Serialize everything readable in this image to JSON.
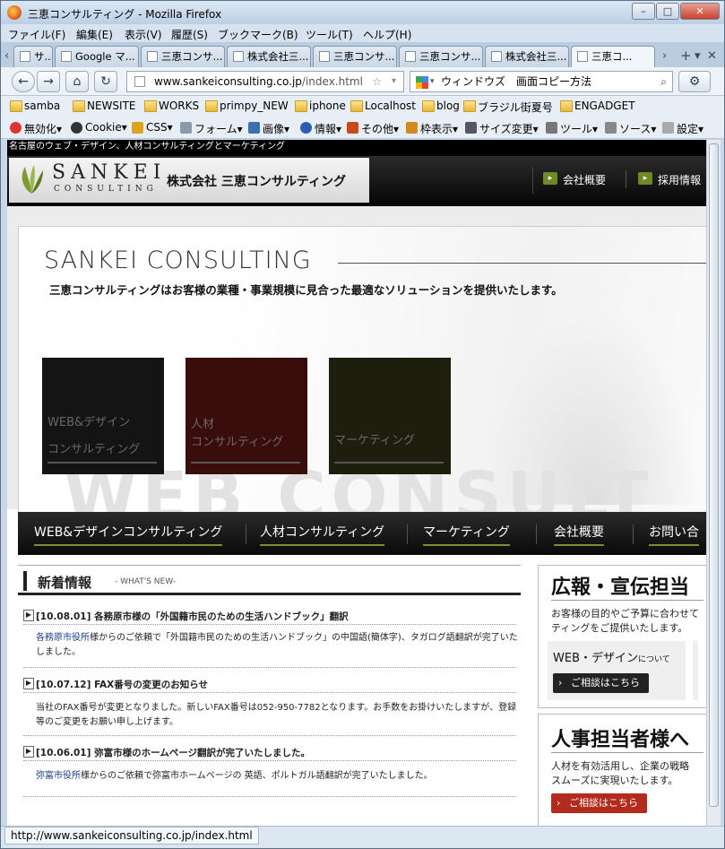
{
  "window": {
    "title": "三恵コンサルティング - Mozilla Firefox",
    "minimize": "–",
    "maximize": "□",
    "close": "✕"
  },
  "menu": [
    "ファイル(F)",
    "編集(E)",
    "表示(V)",
    "履歴(S)",
    "ブックマーク(B)",
    "ツール(T)",
    "ヘルプ(H)"
  ],
  "tabs": [
    {
      "label": "サ..."
    },
    {
      "label": "Google マ..."
    },
    {
      "label": "三恵コンサ..."
    },
    {
      "label": "株式会社三..."
    },
    {
      "label": "三恵コンサ..."
    },
    {
      "label": "三恵コンサ..."
    },
    {
      "label": "株式会社三..."
    },
    {
      "label": "三恵コ...",
      "active": true
    }
  ],
  "nav": {
    "url_host": "www.sankeiconsulting.co.jp",
    "url_path": "/index.html",
    "search_value": "ウィンドウズ　画面コピー方法"
  },
  "bookmarks": [
    "samba",
    "NEWSITE",
    "WORKS",
    "primpy_NEW",
    "iphone",
    "Localhost",
    "blog",
    "ブラジル街夏号",
    "ENGADGET"
  ],
  "devtools": [
    "無効化▾",
    "Cookie▾",
    "CSS▾",
    "フォーム▾",
    "画像▾",
    "情報▾",
    "その他▾",
    "枠表示▾",
    "サイズ変更▾",
    "ツール▾",
    "ソース▾",
    "設定▾"
  ],
  "page": {
    "strip": "名古屋のウェブ・デザイン、人材コンサルティングとマーケティング",
    "brand": "SANKEI",
    "brand_sub": "CONSULTING",
    "company": "株式会社 三恵コンサルティング",
    "header_nav": [
      "会社概要",
      "採用情報"
    ],
    "hero_title": "SANKEI CONSULTING",
    "hero_sub": "三恵コンサルティングはお客様の業種・事業規模に見合った最適なソリューションを提供いたします。",
    "watermark": "WEB CONSULT",
    "cards": [
      {
        "line1": "WEB&デザイン",
        "line2": "コンサルティング"
      },
      {
        "line1": "人材",
        "line2": "コンサルティング"
      },
      {
        "line1": "マーケティング",
        "line2": ""
      }
    ],
    "main_nav": [
      "WEB&デザインコンサルティング",
      "人材コンサルティング",
      "マーケティング",
      "会社概要",
      "お問い合"
    ],
    "news_title": "新着情報",
    "news_sub": "- WHAT'S NEW-",
    "news": [
      {
        "title": "[10.08.01] 各務原市様の「外国籍市民のための生活ハンドブック」翻訳",
        "body_link": "各務原市役所",
        "body": "様からのご依頼で「外国籍市民のための生活ハンドブック」の中国語(簡体字)、タガログ語翻訳が完了いたしました。"
      },
      {
        "title": "[10.07.12] FAX番号の変更のお知らせ",
        "body_link": "",
        "body": "当社のFAX番号が変更となりました。新しいFAX番号は052-950-7782となります。お手数をお掛けいたしますが、登録等のご変更をお願い申し上げます。"
      },
      {
        "title": "[10.06.01] 弥富市様のホームページ翻訳が完了いたしました。",
        "body_link": "弥富市役所",
        "body": "様からのご依頼で弥富市ホームページの 英語、ポルトガル語翻訳が完了いたしました。"
      }
    ],
    "side1": {
      "title": "広報・宣伝担当",
      "text1": "お客様の目的やご予算に合わせて",
      "text2": "ティングをご提供いたします。",
      "label": "WEB・デザイン",
      "label_small": "について",
      "button": "ご相談はこちら"
    },
    "side2": {
      "title": "人事担当者様へ",
      "text1": "人材を有効活用し、企業の戦略",
      "text2": "スムーズに実現いたします。",
      "button": "ご相談はこちら"
    }
  },
  "status": "http://www.sankeiconsulting.co.jp/index.html"
}
